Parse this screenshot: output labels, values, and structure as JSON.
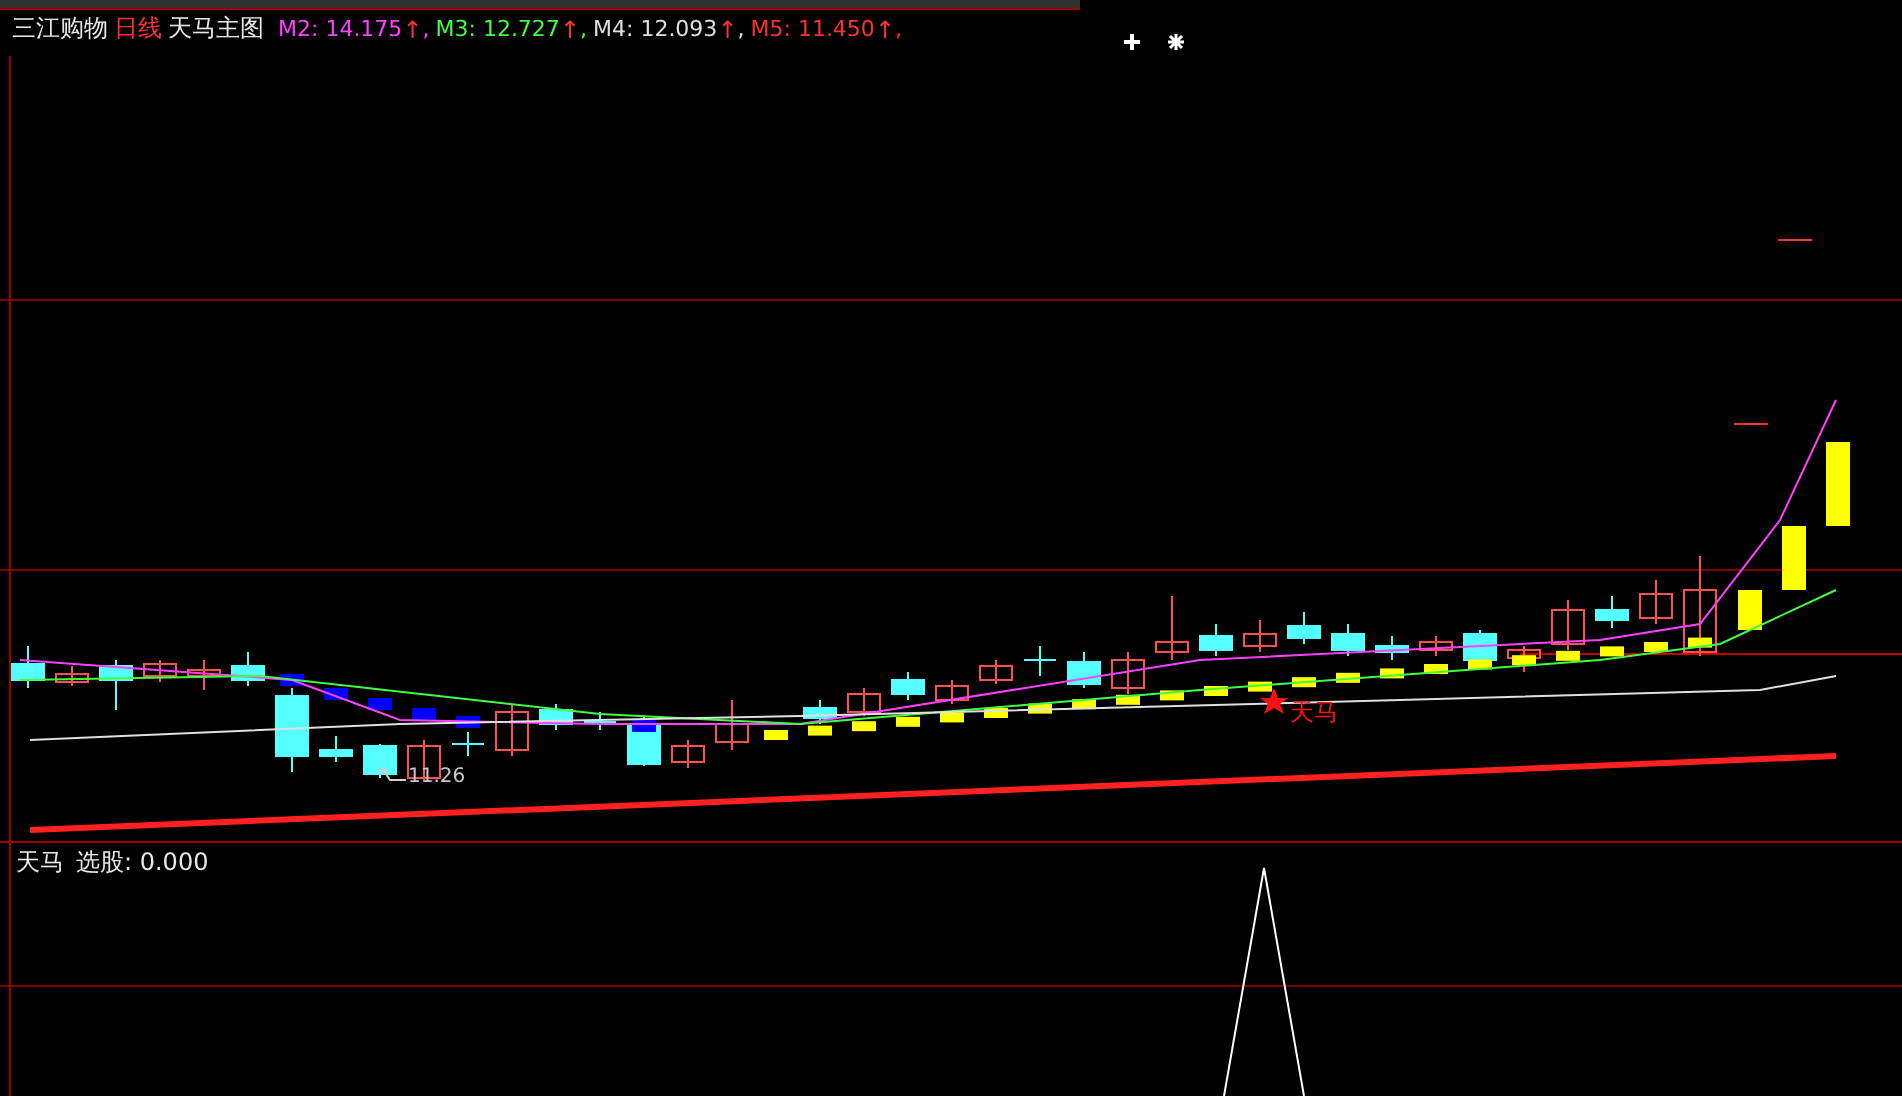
{
  "header": {
    "stock": "三江购物",
    "period": "日线",
    "indicator": "天马主图",
    "averages": [
      {
        "text": "M2: 14.175",
        "arrow": "↑",
        "sep": ",",
        "color": "#ff40ff"
      },
      {
        "text": "M3: 12.727",
        "arrow": "↑",
        "sep": ",",
        "color": "#40ff40"
      },
      {
        "text": "M4: 12.093",
        "arrow": "↑",
        "sep": ",",
        "color": "#e0e0e0"
      },
      {
        "text": "M5: 11.450",
        "arrow": "↑",
        "sep": ",",
        "color": "#ff3030"
      }
    ]
  },
  "chart": {
    "signal_label": "天马",
    "low_label": "11.26"
  },
  "lower_panel": {
    "title": "天马",
    "reading": "选股: 0.000"
  }
}
